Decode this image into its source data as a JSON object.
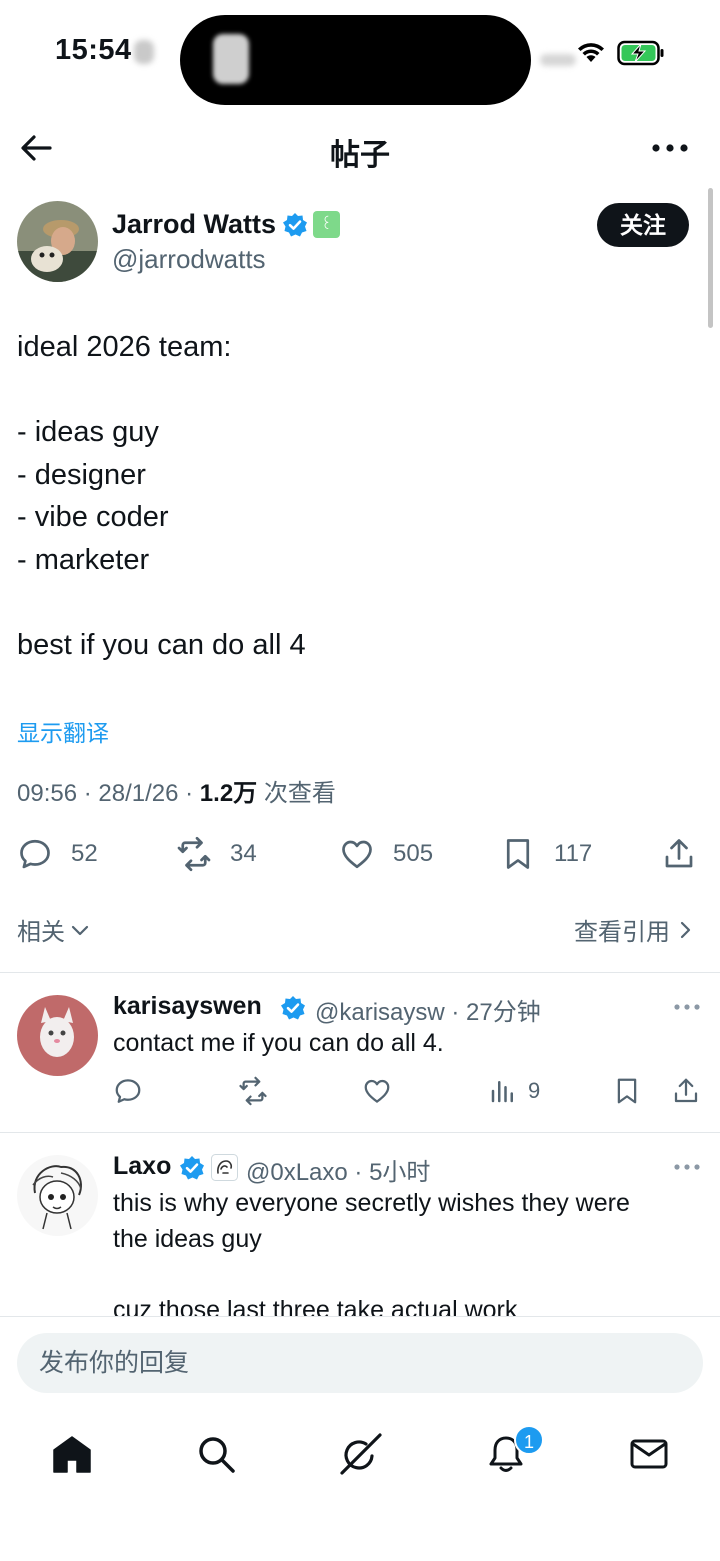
{
  "status_bar": {
    "time": "15:54"
  },
  "nav": {
    "title": "帖子"
  },
  "author": {
    "name": "Jarrod Watts",
    "handle": "@jarrodwatts",
    "follow_label": "关注",
    "affiliate_glyph": "꒰"
  },
  "tweet": {
    "lines": [
      "ideal 2026 team:",
      "",
      "- ideas guy",
      "- designer",
      "- vibe coder",
      "- marketer",
      "",
      "best if you can do all 4"
    ],
    "translate_label": "显示翻译",
    "timestamp": "09:56 · 28/1/26 · ",
    "views": "1.2万",
    "views_label": " 次查看"
  },
  "actions": {
    "replies": "52",
    "reposts": "34",
    "likes": "505",
    "bookmarks": "117"
  },
  "related_label": "相关",
  "quotes_label": "查看引用",
  "replies": [
    {
      "name": "karisayswen",
      "handle": "@karisaysw · 27分钟",
      "text": "contact me if you can do all 4.",
      "views": "9"
    },
    {
      "name": "Laxo",
      "handle": "@0xLaxo · 5小时",
      "text_lines": [
        "this is why everyone secretly wishes they were",
        "the ideas guy",
        "",
        "cuz those last three take actual work"
      ]
    }
  ],
  "reply_box": {
    "placeholder": "发布你的回复"
  },
  "tab_bar": {
    "notification_count": "1"
  },
  "colors": {
    "accent": "#1d9bf0",
    "text": "#0f1419",
    "secondary": "#536471"
  }
}
